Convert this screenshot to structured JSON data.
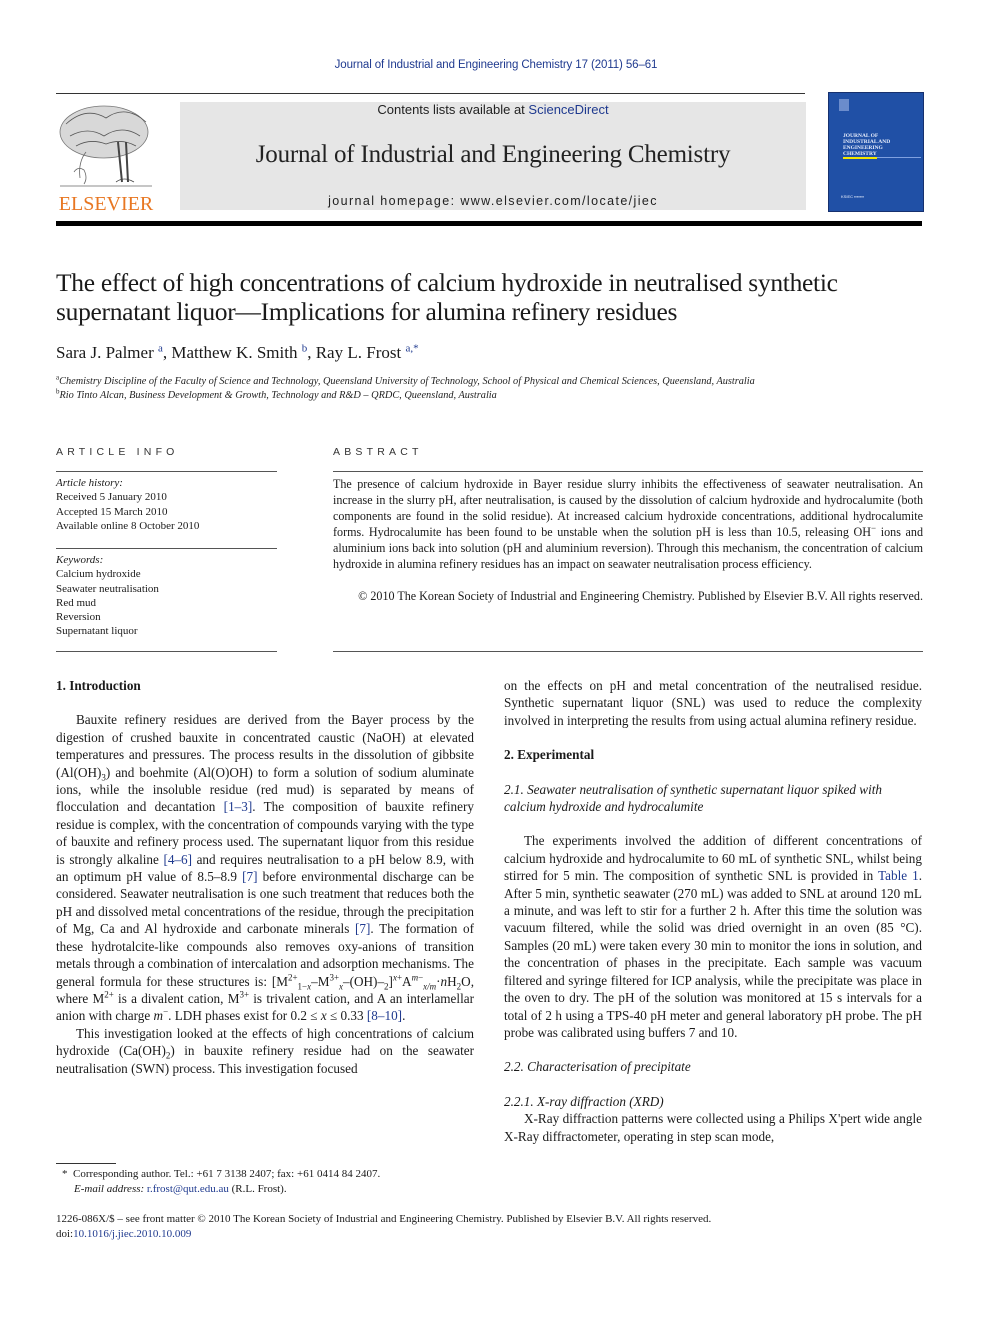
{
  "header": {
    "running_head": "Journal of Industrial and Engineering Chemistry 17 (2011) 56–61",
    "contents_prefix": "Contents lists available at ",
    "contents_link": "ScienceDirect",
    "journal_title": "Journal of Industrial and Engineering Chemistry",
    "homepage": "journal homepage: www.elsevier.com/locate/jiec",
    "publisher_logo": "ELSEVIER",
    "cover_title_lines": [
      "JOURNAL OF",
      "INDUSTRIAL AND",
      "ENGINEERING",
      "CHEMISTRY"
    ],
    "colors": {
      "link": "#1f3a8f",
      "elsevier_orange": "#e87722",
      "cover_blue": "#2050a6",
      "cover_accent": "#f2e600",
      "banner_gray": "#e6e6e6"
    }
  },
  "article": {
    "title_line1": "The effect of high concentrations of calcium hydroxide in neutralised synthetic",
    "title_line2": "supernatant liquor—Implications for alumina refinery residues",
    "authors": [
      {
        "name": "Sara J. Palmer",
        "sup": "a",
        "sep": ", "
      },
      {
        "name": "Matthew K. Smith",
        "sup": "b",
        "sep": ", "
      },
      {
        "name": "Ray L. Frost",
        "sup": "a,*",
        "sep": ""
      }
    ],
    "affiliations": [
      {
        "mark": "a",
        "text": "Chemistry Discipline of the Faculty of Science and Technology, Queensland University of Technology, School of Physical and Chemical Sciences, Queensland, Australia"
      },
      {
        "mark": "b",
        "text": "Rio Tinto Alcan, Business Development & Growth, Technology and R&D – QRDC, Queensland, Australia"
      }
    ]
  },
  "article_info": {
    "heading": "ARTICLE INFO",
    "history_label": "Article history:",
    "history": [
      "Received 5 January 2010",
      "Accepted 15 March 2010",
      "Available online 8 October 2010"
    ],
    "keywords_label": "Keywords:",
    "keywords": [
      "Calcium hydroxide",
      "Seawater neutralisation",
      "Red mud",
      "Reversion",
      "Supernatant liquor"
    ]
  },
  "abstract": {
    "heading": "ABSTRACT",
    "text_1": "The presence of calcium hydroxide in Bayer residue slurry inhibits the effectiveness of seawater neutralisation. An increase in the slurry pH, after neutralisation, is caused by the dissolution of calcium hydroxide and hydrocalumite (both components are found in the solid residue). At increased calcium hydroxide concentrations, additional hydrocalumite forms. Hydrocalumite has been found to be unstable when the solution pH is less than 10.5, releasing OH",
    "text_sup": "−",
    "text_2": " ions and aluminium ions back into solution (pH and aluminium reversion). Through this mechanism, the concentration of calcium hydroxide in alumina refinery residues has an impact on seawater neutralisation process efficiency.",
    "copyright": "© 2010 The Korean Society of Industrial and Engineering Chemistry. Published by Elsevier B.V. All rights reserved."
  },
  "body": {
    "intro_heading": "1.  Introduction",
    "intro_p1": {
      "a": "Bauxite refinery residues are derived from the Bayer process by the digestion of crushed bauxite in concentrated caustic (NaOH) at elevated temperatures and pressures. The process results in the dissolution of gibbsite (Al(OH)",
      "a_sub": "3",
      "b": ") and boehmite (Al(O)OH) to form a solution of sodium aluminate ions, while the insoluble residue (red mud) is separated by means of flocculation and decantation ",
      "ref1": "[1–3]",
      "c": ". The composition of bauxite refinery residue is complex, with the concentration of compounds varying with the type of bauxite and refinery process used. The supernatant liquor from this residue is strongly alkaline ",
      "ref2": "[4–6]",
      "d": " and requires neutralisation to a pH below 8.9, with an optimum pH value of 8.5–8.9 ",
      "ref3": "[7]",
      "e": " before environmental discharge can be considered. Seawater neutralisation is one such treatment that reduces both the pH and dissolved metal concentrations of the residue, through the precipitation of Mg, Ca and Al hydroxide and carbonate minerals ",
      "ref4": "[7]",
      "f": ". The formation of these hydrotalcite-like compounds also removes oxy-anions of transition metals through a combination of intercalation and adsorption mechanisms. The general formula for these structures is: [M",
      "formula_tail": "]",
      "g": " is a divalent cation, M",
      "h": " is trivalent cation, and A an interlamellar anion with charge ",
      "i": ". LDH phases exist for 0.2 ≤ ",
      "j": " ≤ 0.33 ",
      "ref5": "[8–10]",
      "k": "."
    },
    "intro_p2": {
      "a": "This investigation looked at the effects of high concentrations of calcium hydroxide (Ca(OH)",
      "a_sub": "2",
      "b": ") in bauxite refinery residue had on the seawater neutralisation (SWN) process. This investigation focused on the effects on pH and metal concentration of the neutralised residue. Synthetic supernatant liquor (SNL) was used to reduce the complexity involved in interpreting the results from using actual alumina refinery residue."
    },
    "exp_heading": "2.  Experimental",
    "sub21_heading": "2.1.  Seawater neutralisation of synthetic supernatant liquor spiked with calcium hydroxide and hydrocalumite",
    "sub21_p": {
      "a": "The experiments involved the addition of different concentrations of calcium hydroxide and hydrocalumite to 60 mL of synthetic SNL, whilst being stirred for 5 min. The composition of synthetic SNL is provided in ",
      "table_ref": "Table 1",
      "b": ". After 5 min, synthetic seawater (270 mL) was added to SNL at around 120 mL a minute, and was left to stir for a further 2 h. After this time the solution was vacuum filtered, while the solid was dried overnight in an oven (85 °C). Samples (20 mL) were taken every 30 min to monitor the ions in solution, and the concentration of phases in the precipitate. Each sample was vacuum filtered and syringe filtered for ICP analysis, while the precipitate was place in the oven to dry. The pH of the solution was monitored at 15 s intervals for a total of 2 h using a TPS-40 pH meter and general laboratory pH probe. The pH probe was calibrated using buffers 7 and 10."
    },
    "sub22_heading": "2.2.  Characterisation of precipitate",
    "sub221_heading": "2.2.1.  X-ray diffraction (XRD)",
    "sub221_p": "X-Ray diffraction patterns were collected using a Philips X'pert wide angle X-Ray diffractometer, operating in step scan mode,"
  },
  "footnote": {
    "mark": "*",
    "line1": "Corresponding author. Tel.: +61 7 3138 2407; fax: +61 0414 84 2407.",
    "email_label": "E-mail address: ",
    "email": "r.frost@qut.edu.au",
    "email_suffix": " (R.L. Frost)."
  },
  "footer": {
    "line1": "1226-086X/$ – see front matter © 2010 The Korean Society of Industrial and Engineering Chemistry. Published by Elsevier B.V. All rights reserved.",
    "doi_label": "doi:",
    "doi": "10.1016/j.jiec.2010.10.009"
  }
}
